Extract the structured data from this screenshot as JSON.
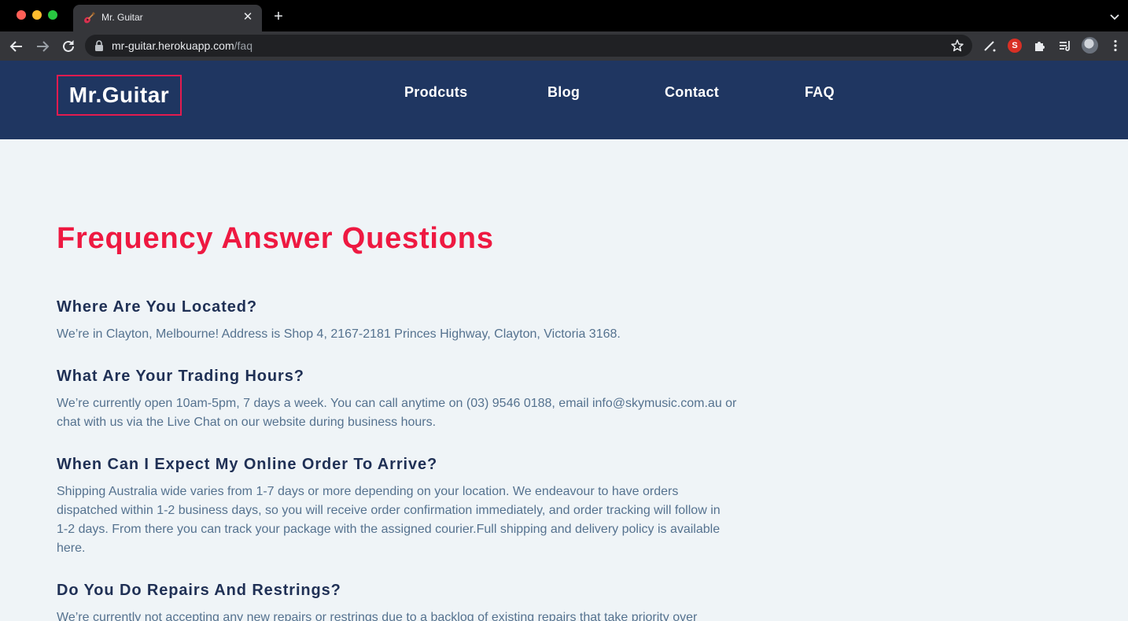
{
  "browser": {
    "tab": {
      "title": "Mr. Guitar",
      "favicon": "guitar-icon"
    },
    "url": {
      "host": "mr-guitar.herokuapp.com",
      "path": "/faq"
    },
    "icons": [
      "back-arrow-icon",
      "forward-arrow-icon",
      "reload-icon",
      "lock-icon",
      "star-icon",
      "pen-extension-icon",
      "s-extension-icon",
      "puzzle-icon",
      "reading-list-icon",
      "profile-avatar",
      "kebab-menu-icon"
    ],
    "s_extension_label": "S"
  },
  "colors": {
    "header_bg": "#1f3661",
    "page_bg": "#eff4f7",
    "accent_red": "#ee1941",
    "question_text": "#1f3055",
    "answer_text": "#55728f"
  },
  "site": {
    "logo": "Mr.Guitar",
    "nav": [
      {
        "label": "Prodcuts"
      },
      {
        "label": "Blog"
      },
      {
        "label": "Contact"
      },
      {
        "label": "FAQ"
      }
    ]
  },
  "faq": {
    "title": "Frequency Answer Questions",
    "items": [
      {
        "question": "Where Are You Located?",
        "answer": "We’re in Clayton, Melbourne! Address is Shop 4, 2167-2181 Princes Highway, Clayton, Victoria 3168."
      },
      {
        "question": "What Are Your Trading Hours?",
        "answer": "We’re currently open 10am-5pm, 7 days a week. You can call anytime on (03) 9546 0188, email info@skymusic.com.au or chat with us via the Live Chat on our website during business hours."
      },
      {
        "question": "When Can I Expect My Online Order To Arrive?",
        "answer": "Shipping Australia wide varies from 1-7 days or more depending on your location. We endeavour to have orders dispatched within 1-2 business days, so you will receive order confirmation immediately, and order tracking will follow in 1-2 days. From there you can track your package with the assigned courier.Full shipping and delivery policy is available here."
      },
      {
        "question": "Do You Do Repairs And Restrings?",
        "answer": "We’re currently not accepting any new repairs or restrings due to a backlog of existing repairs that take priority over"
      }
    ]
  }
}
